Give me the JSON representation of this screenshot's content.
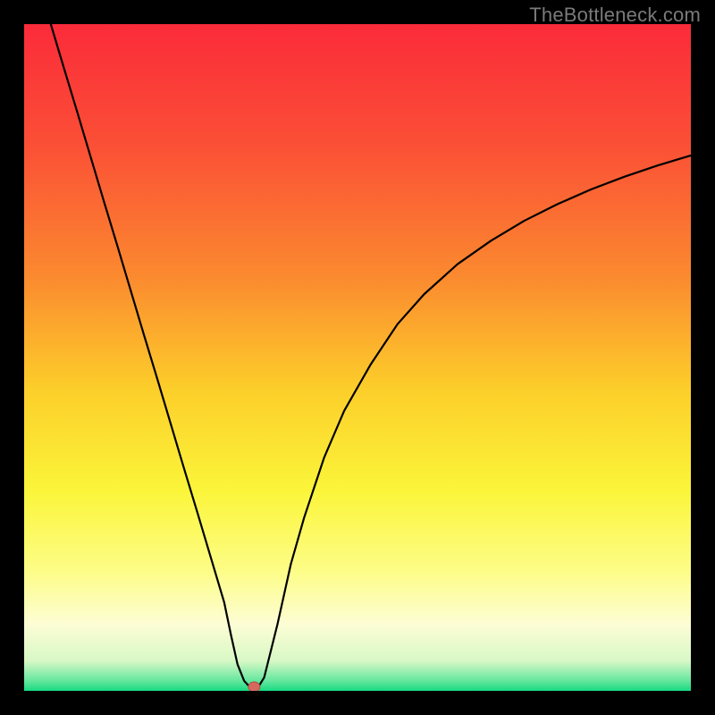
{
  "watermark": "TheBottleneck.com",
  "colors": {
    "frame": "#000000",
    "curve": "#000000",
    "marker_fill": "#d46a5f",
    "marker_stroke": "#b44c41",
    "gradient_stops": [
      {
        "offset": 0.0,
        "color": "#fb2b3a"
      },
      {
        "offset": 0.18,
        "color": "#fb4f36"
      },
      {
        "offset": 0.38,
        "color": "#fb8a2f"
      },
      {
        "offset": 0.55,
        "color": "#fccf2a"
      },
      {
        "offset": 0.7,
        "color": "#fbf53a"
      },
      {
        "offset": 0.82,
        "color": "#fdfd87"
      },
      {
        "offset": 0.9,
        "color": "#fdfdd5"
      },
      {
        "offset": 0.955,
        "color": "#d8f8c6"
      },
      {
        "offset": 0.985,
        "color": "#64e79e"
      },
      {
        "offset": 1.0,
        "color": "#17d981"
      }
    ]
  },
  "chart_data": {
    "type": "line",
    "title": "",
    "xlabel": "",
    "ylabel": "",
    "xlim": [
      0,
      100
    ],
    "ylim": [
      0,
      100
    ],
    "x": [
      4,
      6,
      8,
      10,
      12,
      14,
      16,
      18,
      20,
      22,
      24,
      26,
      28,
      30,
      31,
      32,
      33,
      34,
      35,
      36,
      38,
      40,
      42,
      45,
      48,
      52,
      56,
      60,
      65,
      70,
      75,
      80,
      85,
      90,
      95,
      100
    ],
    "values": [
      100,
      93.3,
      86.7,
      80.0,
      73.3,
      66.7,
      60.0,
      53.3,
      46.7,
      40.0,
      33.3,
      26.7,
      20.0,
      13.3,
      8.5,
      4.0,
      1.5,
      0.4,
      0.4,
      2.0,
      10.0,
      19.0,
      26.0,
      35.0,
      42.0,
      49.0,
      55.0,
      59.5,
      64.0,
      67.5,
      70.5,
      73.0,
      75.2,
      77.1,
      78.8,
      80.3
    ],
    "marker": {
      "x": 34.5,
      "y": 0.6
    }
  }
}
